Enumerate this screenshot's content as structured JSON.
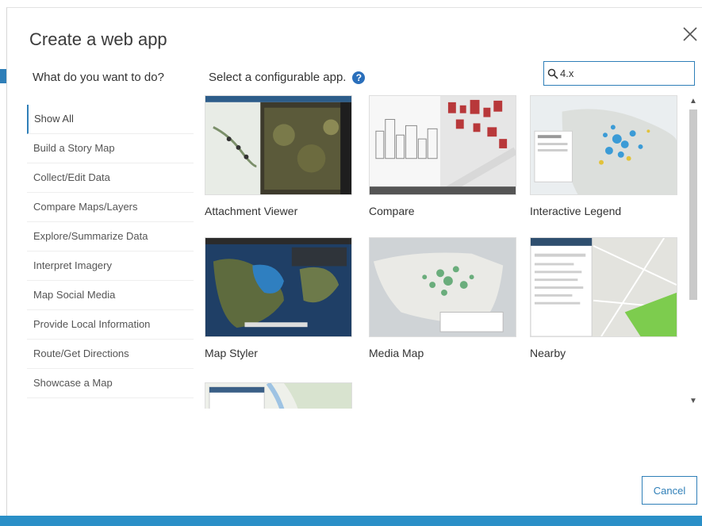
{
  "dialog": {
    "title": "Create a web app",
    "left_heading": "What do you want to do?",
    "mid_heading": "Select a configurable app.",
    "help_symbol": "?",
    "search_value": "4.x",
    "cancel_label": "Cancel"
  },
  "categories": [
    {
      "label": "Show All"
    },
    {
      "label": "Build a Story Map"
    },
    {
      "label": "Collect/Edit Data"
    },
    {
      "label": "Compare Maps/Layers"
    },
    {
      "label": "Explore/Summarize Data"
    },
    {
      "label": "Interpret Imagery"
    },
    {
      "label": "Map Social Media"
    },
    {
      "label": "Provide Local Information"
    },
    {
      "label": "Route/Get Directions"
    },
    {
      "label": "Showcase a Map"
    }
  ],
  "apps": [
    {
      "label": "Attachment Viewer"
    },
    {
      "label": "Compare"
    },
    {
      "label": "Interactive Legend"
    },
    {
      "label": "Map Styler"
    },
    {
      "label": "Media Map"
    },
    {
      "label": "Nearby"
    },
    {
      "label": ""
    }
  ],
  "icons": {
    "close": "close-icon",
    "search": "search-icon",
    "help": "help-icon"
  },
  "colors": {
    "accent": "#2f7fb8",
    "bottom_bar": "#2a8fc7",
    "help": "#2a6fbb"
  }
}
